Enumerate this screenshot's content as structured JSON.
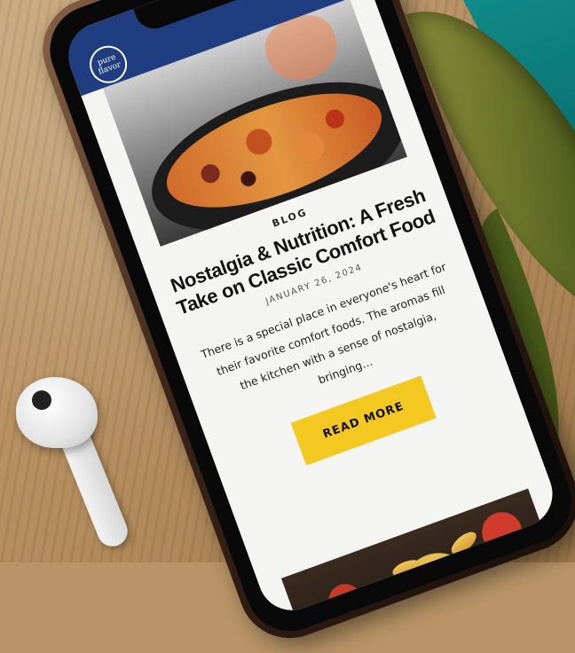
{
  "header": {
    "logo_text": "pure flavor",
    "menu_icon": "hamburger-icon"
  },
  "post": {
    "category": "BLOG",
    "title": "Nostalgia & Nutrition: A Fresh Take on Classic Comfort Food",
    "date": "JANUARY 26, 2024",
    "excerpt": "There is a special place in everyone's heart for their favorite comfort foods. The aromas fill the kitchen with a sense of nostalgia, bringing…",
    "read_more_label": "READ MORE"
  },
  "colors": {
    "header_bg": "#1f3d7f",
    "button_bg": "#f2c821",
    "screen_bg": "#f4f4f3"
  }
}
